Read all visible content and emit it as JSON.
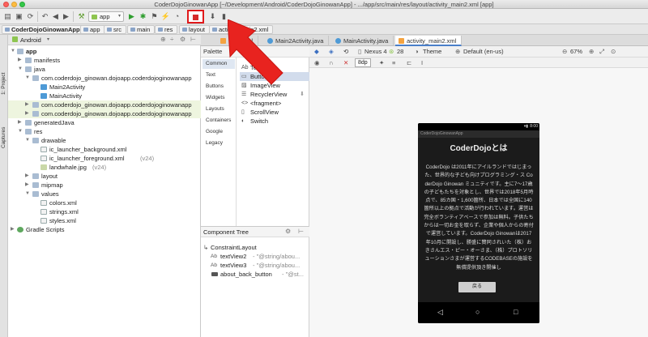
{
  "window": {
    "title": "CoderDojoGinowanApp [~/Development/Android/CoderDojoGinowanApp] - .../app/src/main/res/layout/activity_main2.xml [app]"
  },
  "toolbar": {
    "run_config": "app",
    "stop_icon_name": "stop-icon",
    "stop_color": "#d62b2b"
  },
  "breadcrumb": [
    "CoderDojoGinowanApp",
    "app",
    "src",
    "main",
    "res",
    "layout",
    "activity_main2.xml"
  ],
  "left_strip": {
    "project_tab": "1: Project",
    "captures_tab": "Captures"
  },
  "project": {
    "view_selector": "Android",
    "items": [
      {
        "label": "app",
        "sub": ""
      },
      {
        "label": "manifests",
        "sub": ""
      },
      {
        "label": "java",
        "sub": ""
      },
      {
        "label": "com.coderdojo_ginowan.dojoapp.coderdojoginowanapp",
        "sub": ""
      },
      {
        "label": "Main2Activity",
        "sub": ""
      },
      {
        "label": "MainActivity",
        "sub": ""
      },
      {
        "label": "com.coderdojo_ginowan.dojoapp.coderdojoginowanapp",
        "sub": ""
      },
      {
        "label": "com.coderdojo_ginowan.dojoapp.coderdojoginowanapp",
        "sub": ""
      },
      {
        "label": "generatedJava",
        "sub": ""
      },
      {
        "label": "res",
        "sub": ""
      },
      {
        "label": "drawable",
        "sub": ""
      },
      {
        "label": "ic_launcher_background.xml",
        "sub": ""
      },
      {
        "label": "ic_launcher_foreground.xml",
        "sub": "(v24)"
      },
      {
        "label": "landwhale.jpg",
        "sub": "(v24)"
      },
      {
        "label": "layout",
        "sub": ""
      },
      {
        "label": "mipmap",
        "sub": ""
      },
      {
        "label": "values",
        "sub": ""
      },
      {
        "label": "colors.xml",
        "sub": ""
      },
      {
        "label": "strings.xml",
        "sub": ""
      },
      {
        "label": "styles.xml",
        "sub": ""
      },
      {
        "label": "Gradle Scripts",
        "sub": ""
      }
    ]
  },
  "tabs": [
    "main.xml",
    "Main2Activity.java",
    "MainActivity.java",
    "activity_main2.xml"
  ],
  "palette": {
    "title": "Palette",
    "categories": [
      "Common",
      "Text",
      "Buttons",
      "Widgets",
      "Layouts",
      "Containers",
      "Google",
      "Legacy"
    ],
    "widgets": [
      "TextView",
      "Button",
      "ImageView",
      "RecyclerView",
      "<fragment>",
      "ScrollView",
      "Switch"
    ]
  },
  "component_tree": {
    "title": "Component Tree",
    "items": [
      {
        "prefix": "",
        "label": "ConstraintLayout",
        "attr": ""
      },
      {
        "prefix": "Ab",
        "label": "textView2",
        "attr": "- \"@string/abou..."
      },
      {
        "prefix": "Ab",
        "label": "textView3",
        "attr": "- \"@string/abou..."
      },
      {
        "prefix": "",
        "label": "about_back_button",
        "attr": "- \"@st..."
      }
    ]
  },
  "design_toolbar": {
    "device": "Nexus 4",
    "api": "28",
    "theme": "Theme",
    "locale": "Default (en-us)",
    "zoom": "67%",
    "margin": "8dp"
  },
  "phone": {
    "time": "8:00",
    "app_name": "CoderDojoGinowanApp",
    "title": "CoderDojoとは",
    "body": "CoderDojo は2011年にアイルランドではじまった、世界的な子ども向けプログラミング・ス CoderDojo Ginowan ミュニティです。主に7〜17歳の子どもたちを対象とし、世界では2018年5月時点で、85カ国・1,600箇所、日本では全国に140箇所以上の拠点で活動が行われています。運営は完全ボランティアベースで参加は無料。子供たちからは一切お金を取らず、企業や個人からの寄付で運営しています。CoderDojo Ginowanは2017年10月に開設し、勝盛に賛同されいた（株）おきさんエス・ピー・オーさま、（株）プロトソリューションさまが運営するCODEBASEの施設を無償提供頂き開催し",
    "button": "戻る"
  }
}
